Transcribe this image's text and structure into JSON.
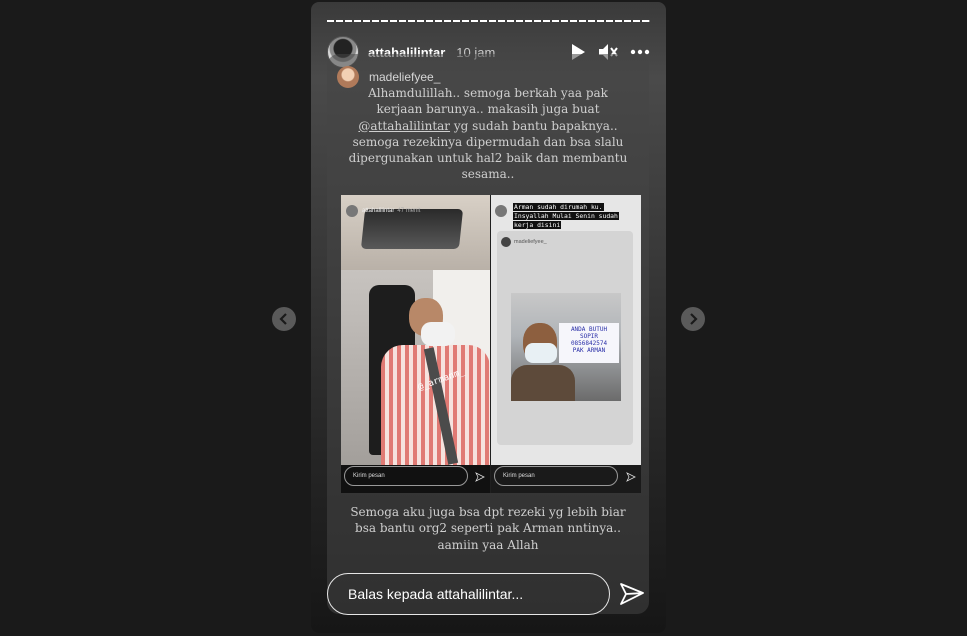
{
  "story": {
    "username": "attahalilintar",
    "time": "10 jam"
  },
  "reply": {
    "username": "madeliefyee_",
    "caption_top": {
      "before": "Alhamdulillah.. semoga berkah yaa pak kerjaan barunya.. makasih juga buat ",
      "mention": "@attahalilintar",
      "after": " yg sudah bantu bapaknya.. semoga rezekinya dipermudah dan bsa slalu dipergunakan untuk hal2 baik dan membantu sesama.."
    },
    "caption_bottom": "Semoga aku juga bsa dpt rezeki yg lebih biar bsa bantu org2 seperti pak Arman nntinya.. aamiin yaa Allah"
  },
  "embedded": {
    "left": {
      "username": "attahalilintar",
      "time": "47 menit",
      "sticker": "@_armanm_",
      "send_placeholder": "Kirim pesan"
    },
    "right": {
      "highlight_lines": [
        "Arman sudah dirumah ku.",
        "Insyallah Mulai Senin sudah",
        "kerja disini"
      ],
      "reply_name": "madeliefyee_",
      "sign_lines": [
        "ANDA BUTUH",
        "SOPIR",
        "0856842574",
        "PAK ARMAN"
      ],
      "send_placeholder": "Kirim pesan"
    }
  },
  "reply_bar": {
    "placeholder": "Balas kepada attahalilintar..."
  },
  "icons": {
    "play": "play-icon",
    "mute": "mute-icon",
    "more": "more-icon",
    "send": "send-icon",
    "prev": "chevron-left-icon",
    "next": "chevron-right-icon"
  }
}
